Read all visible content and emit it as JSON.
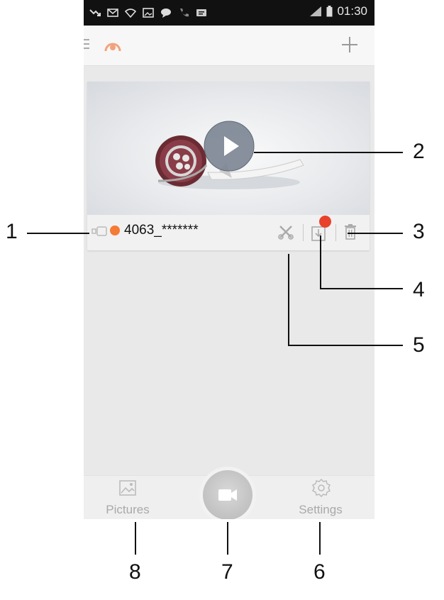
{
  "status_bar": {
    "time": "01:30",
    "icons": [
      "missed-call-icon",
      "mail-icon",
      "wifi-icon",
      "gallery-icon",
      "chat-icon",
      "phone-icon",
      "message-icon",
      "signal-icon",
      "battery-icon"
    ]
  },
  "app_bar": {
    "icons": [
      "menu-icon",
      "logo-icon",
      "add-icon"
    ]
  },
  "device_card": {
    "name": "4063_*******",
    "status_color": "#f47a36",
    "record_badge_color": "#e8422c",
    "icons": [
      "camera-icon",
      "play-icon",
      "tools-icon",
      "record-files-icon",
      "trash-icon"
    ]
  },
  "bottom_nav": {
    "pictures_label": "Pictures",
    "settings_label": "Settings",
    "record_icon": "video-camera-icon"
  },
  "callouts": {
    "c1": "1",
    "c2": "2",
    "c3": "3",
    "c4": "4",
    "c5": "5",
    "c6": "6",
    "c7": "7",
    "c8": "8"
  }
}
